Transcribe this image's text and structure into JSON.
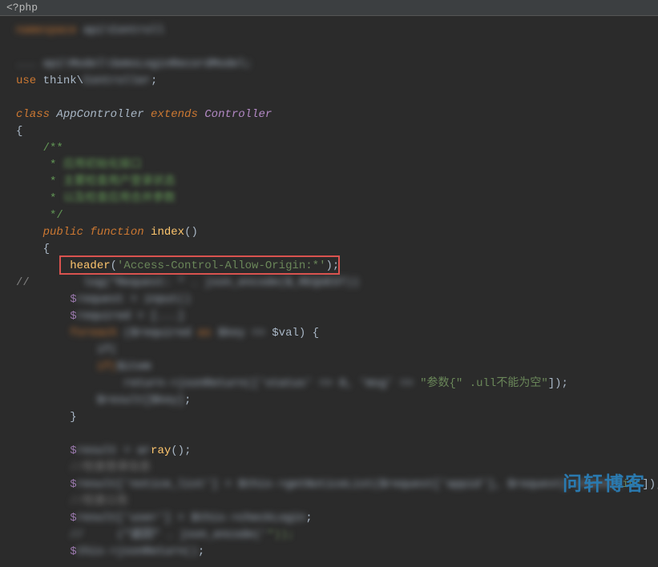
{
  "topbar": {
    "filename": "<?php"
  },
  "code": {
    "l1_namespace_kw": "namespace ",
    "l1_blur": "api\\Controll",
    "l3_pre": "... api\\Model\\",
    "l3_blur": "SemsLoginRecordModel",
    "l3_semicolon": ";",
    "l4_use": "use",
    "l4_think": " think\\",
    "l4_blur": "Controller",
    "l4_semicolon": ";",
    "l5_class": "class",
    "l5_app": " AppController ",
    "l5_extends": "extends",
    "l5_controller": " Controller",
    "l6_brace": "{",
    "l7_docstart": "    /**",
    "l8_doc": "     * ",
    "l8_blur": "应用初始化接口",
    "l9_doc": "     * ",
    "l9_blur": "主要检查用户登录状态",
    "l10_doc": "     * ",
    "l10_blur": "以及检查应用合并参数",
    "l11_docend": "     */",
    "l12_public": "    public",
    "l12_function": " function",
    "l12_index": " index",
    "l12_parens": "()",
    "l13_brace": "    {",
    "l14_header": "        header",
    "l14_paren_open": "(",
    "l14_string": "'Access-Control-Allow-Origin:*'",
    "l14_paren_close": ")",
    "l14_semicolon": ";",
    "l15_comment": "//",
    "l15_blur": "        log(\"Request: \" . json_encode($_REQUEST))",
    "l16_var": "        $",
    "l16_blur": "request = input()",
    "l17_var": "        $",
    "l17_blur": "required = [...]",
    "l18_foreach": "        foreach ",
    "l18_blur1": "($required",
    "l18_as": " as ",
    "l18_blur2": "$key =>",
    "l18_val": " $val) {",
    "l19_blur": "            if(",
    "l20_if": "            if(",
    "l20_blur": "$item",
    "l21_blur1": "                return->jsonReturn(",
    "l21_blur2": "['status' => 0, 'msg' => ",
    "l21_string": "\"参数{\" .ull不能为空\"",
    "l21_end": "]);",
    "l22_blur": "            $result[$key]",
    "l22_end": ";",
    "l23_brace": "        }",
    "l25_var": "        $",
    "l25_blur": "result = ar",
    "l25_ray": "ray",
    "l25_parens": "();",
    "l26_blur": "        //检查登录信息",
    "l27_var": "        $",
    "l27_blur1": "result['notice_list'] = $this->getNoticeList($request['appid'], $request['channel",
    "l27_str": "id'",
    "l27_end": "]);",
    "l28_blur": "        //检查公告",
    "l29_var": "        $",
    "l29_blur": "result['user'] = $this->checkLogin",
    "l29_end": ";",
    "l30_blur": "        //     (\"返回\" . json_encode('",
    "l30_str": "\"));",
    "l31_var": "        $",
    "l31_blur": "this->jsonReturn()",
    "l31_end": ";"
  },
  "watermark": {
    "text": "问轩博客"
  }
}
